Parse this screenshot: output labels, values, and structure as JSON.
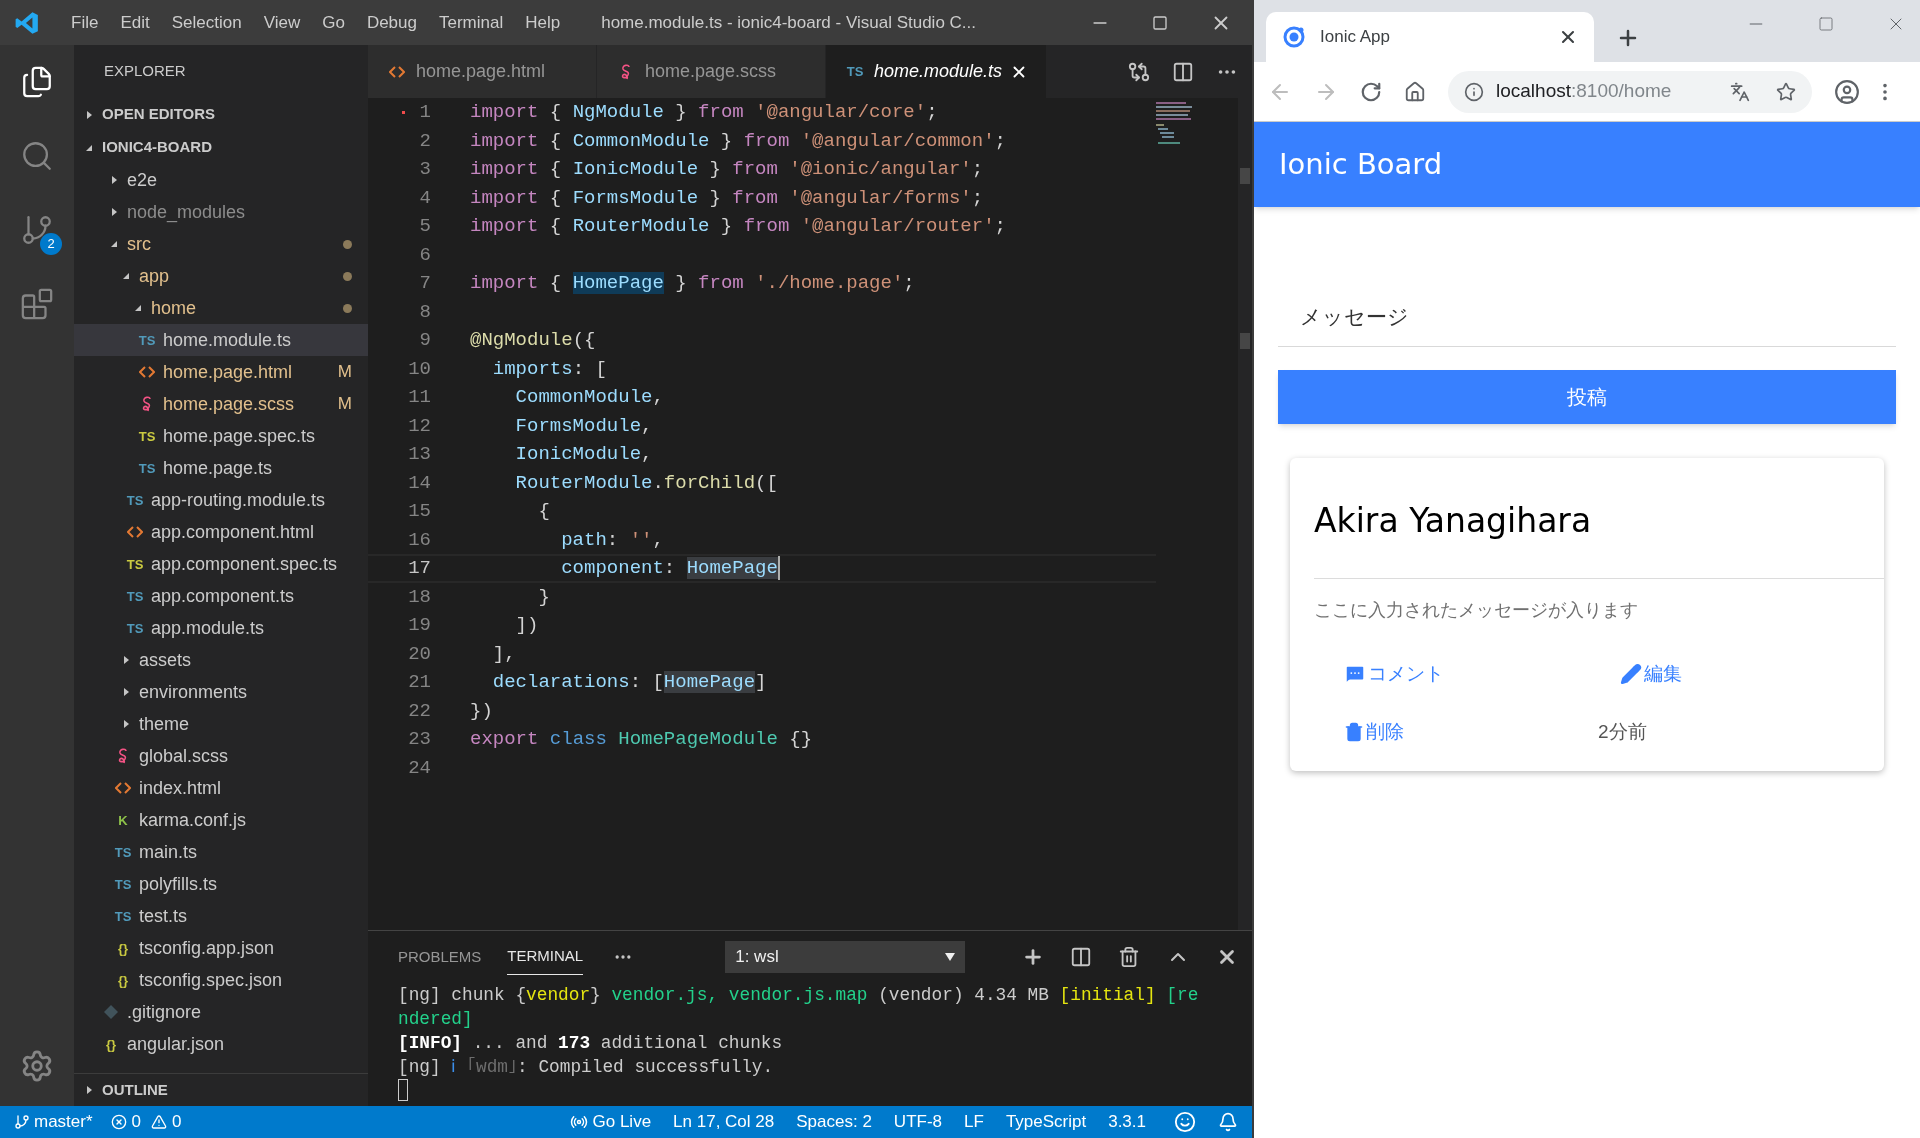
{
  "window": {
    "title": "home.module.ts - ionic4-board - Visual Studio C..."
  },
  "menu": [
    "File",
    "Edit",
    "Selection",
    "View",
    "Go",
    "Debug",
    "Terminal",
    "Help"
  ],
  "activity_bar": [
    {
      "kind": "files",
      "selected": true
    },
    {
      "kind": "search",
      "selected": false
    },
    {
      "kind": "scm",
      "selected": false,
      "badge": "2"
    },
    {
      "kind": "extensions",
      "selected": false
    }
  ],
  "sidebar": {
    "title": "EXPLORER",
    "sections": [
      {
        "label": "OPEN EDITORS",
        "expanded": false
      },
      {
        "label": "IONIC4-BOARD",
        "expanded": true,
        "children": [
          {
            "name": "e2e",
            "expanded": false,
            "selected": false,
            "modified": false,
            "ignored": false
          },
          {
            "name": "node_modules",
            "expanded": false,
            "selected": false,
            "modified": false,
            "ignored": true
          },
          {
            "name": "src",
            "expanded": true,
            "selected": false,
            "modified": true,
            "ignored": false,
            "children": [
              {
                "name": "app",
                "expanded": true,
                "selected": false,
                "modified": true,
                "ignored": false,
                "children": [
                  {
                    "name": "home",
                    "expanded": true,
                    "selected": false,
                    "modified": true,
                    "ignored": false,
                    "children": [
                      {
                        "name": "home.module.ts",
                        "kind": "ts",
                        "icon_text": "TS",
                        "selected": true,
                        "modified": false,
                        "ignored": false
                      },
                      {
                        "name": "home.page.html",
                        "kind": "html",
                        "selected": false,
                        "modified": true,
                        "ignored": false,
                        "badge": "M"
                      },
                      {
                        "name": "home.page.scss",
                        "kind": "scss",
                        "selected": false,
                        "modified": true,
                        "ignored": false,
                        "badge": "M"
                      },
                      {
                        "name": "home.page.spec.ts",
                        "kind": "ts-test",
                        "icon_text": "TS",
                        "selected": false,
                        "modified": false,
                        "ignored": false
                      },
                      {
                        "name": "home.page.ts",
                        "kind": "ts",
                        "icon_text": "TS",
                        "selected": false,
                        "modified": false,
                        "ignored": false
                      }
                    ]
                  },
                  {
                    "name": "app-routing.module.ts",
                    "kind": "ts",
                    "icon_text": "TS",
                    "selected": false,
                    "modified": false,
                    "ignored": false
                  },
                  {
                    "name": "app.component.html",
                    "kind": "html",
                    "selected": false,
                    "modified": false,
                    "ignored": false
                  },
                  {
                    "name": "app.component.spec.ts",
                    "kind": "ts-test",
                    "icon_text": "TS",
                    "selected": false,
                    "modified": false,
                    "ignored": false
                  },
                  {
                    "name": "app.component.ts",
                    "kind": "ts",
                    "icon_text": "TS",
                    "selected": false,
                    "modified": false,
                    "ignored": false
                  },
                  {
                    "name": "app.module.ts",
                    "kind": "ts",
                    "icon_text": "TS",
                    "selected": false,
                    "modified": false,
                    "ignored": false
                  }
                ]
              },
              {
                "name": "assets",
                "expanded": false,
                "selected": false,
                "modified": false,
                "ignored": false
              },
              {
                "name": "environments",
                "expanded": false,
                "selected": false,
                "modified": false,
                "ignored": false
              },
              {
                "name": "theme",
                "expanded": false,
                "selected": false,
                "modified": false,
                "ignored": false
              },
              {
                "name": "global.scss",
                "kind": "scss",
                "selected": false,
                "modified": false,
                "ignored": false
              },
              {
                "name": "index.html",
                "kind": "html",
                "selected": false,
                "modified": false,
                "ignored": false
              },
              {
                "name": "karma.conf.js",
                "kind": "karma",
                "icon_text": "K",
                "selected": false,
                "modified": false,
                "ignored": false
              },
              {
                "name": "main.ts",
                "kind": "ts",
                "icon_text": "TS",
                "selected": false,
                "modified": false,
                "ignored": false
              },
              {
                "name": "polyfills.ts",
                "kind": "ts",
                "icon_text": "TS",
                "selected": false,
                "modified": false,
                "ignored": false
              },
              {
                "name": "test.ts",
                "kind": "ts",
                "icon_text": "TS",
                "selected": false,
                "modified": false,
                "ignored": false
              },
              {
                "name": "tsconfig.app.json",
                "kind": "json",
                "icon_text": "{}",
                "selected": false,
                "modified": false,
                "ignored": false
              },
              {
                "name": "tsconfig.spec.json",
                "kind": "json",
                "icon_text": "{}",
                "selected": false,
                "modified": false,
                "ignored": false
              }
            ]
          },
          {
            "name": ".gitignore",
            "kind": "git",
            "selected": false,
            "modified": false,
            "ignored": false
          },
          {
            "name": "angular.json",
            "kind": "json",
            "icon_text": "{}",
            "selected": false,
            "modified": false,
            "ignored": false
          }
        ]
      },
      {
        "label": "OUTLINE",
        "expanded": false
      }
    ]
  },
  "editor_tabs": [
    {
      "label": "home.page.html",
      "kind": "html",
      "selected": false,
      "preview": false
    },
    {
      "label": "home.page.scss",
      "kind": "scss",
      "selected": false,
      "preview": false
    },
    {
      "label": "home.module.ts",
      "kind": "ts",
      "icon_text": "TS",
      "selected": true,
      "preview": true
    }
  ],
  "code": [
    {
      "n": "1",
      "marker": true,
      "current": false,
      "tokens": [
        {
          "kind": "kw",
          "text": "import"
        },
        {
          "kind": "p",
          "text": " { "
        },
        {
          "kind": "v",
          "text": "NgModule"
        },
        {
          "kind": "p",
          "text": " } "
        },
        {
          "kind": "kw",
          "text": "from"
        },
        {
          "kind": "s",
          "text": " '@angular/core'"
        },
        {
          "kind": "p",
          "text": ";"
        }
      ]
    },
    {
      "n": "2",
      "marker": false,
      "current": false,
      "tokens": [
        {
          "kind": "kw",
          "text": "import"
        },
        {
          "kind": "p",
          "text": " { "
        },
        {
          "kind": "v",
          "text": "CommonModule"
        },
        {
          "kind": "p",
          "text": " } "
        },
        {
          "kind": "kw",
          "text": "from"
        },
        {
          "kind": "s",
          "text": " '@angular/common'"
        },
        {
          "kind": "p",
          "text": ";"
        }
      ]
    },
    {
      "n": "3",
      "marker": false,
      "current": false,
      "tokens": [
        {
          "kind": "kw",
          "text": "import"
        },
        {
          "kind": "p",
          "text": " { "
        },
        {
          "kind": "v",
          "text": "IonicModule"
        },
        {
          "kind": "p",
          "text": " } "
        },
        {
          "kind": "kw",
          "text": "from"
        },
        {
          "kind": "s",
          "text": " '@ionic/angular'"
        },
        {
          "kind": "p",
          "text": ";"
        }
      ]
    },
    {
      "n": "4",
      "marker": false,
      "current": false,
      "tokens": [
        {
          "kind": "kw",
          "text": "import"
        },
        {
          "kind": "p",
          "text": " { "
        },
        {
          "kind": "v",
          "text": "FormsModule"
        },
        {
          "kind": "p",
          "text": " } "
        },
        {
          "kind": "kw",
          "text": "from"
        },
        {
          "kind": "s",
          "text": " '@angular/forms'"
        },
        {
          "kind": "p",
          "text": ";"
        }
      ]
    },
    {
      "n": "5",
      "marker": false,
      "current": false,
      "tokens": [
        {
          "kind": "kw",
          "text": "import"
        },
        {
          "kind": "p",
          "text": " { "
        },
        {
          "kind": "v",
          "text": "RouterModule"
        },
        {
          "kind": "p",
          "text": " } "
        },
        {
          "kind": "kw",
          "text": "from"
        },
        {
          "kind": "s",
          "text": " '@angular/router'"
        },
        {
          "kind": "p",
          "text": ";"
        }
      ]
    },
    {
      "n": "6",
      "marker": false,
      "current": false
    },
    {
      "n": "7",
      "marker": false,
      "current": false,
      "tokens": [
        {
          "kind": "kw",
          "text": "import"
        },
        {
          "kind": "p",
          "text": " { "
        },
        {
          "kind": "v",
          "text": "HomePage",
          "matched": true
        },
        {
          "kind": "p",
          "text": " } "
        },
        {
          "kind": "kw",
          "text": "from"
        },
        {
          "kind": "s",
          "text": " './home.page'"
        },
        {
          "kind": "p",
          "text": ";"
        }
      ]
    },
    {
      "n": "8",
      "marker": false,
      "current": false
    },
    {
      "n": "9",
      "marker": false,
      "current": false,
      "tokens": [
        {
          "kind": "fn",
          "text": "@NgModule"
        },
        {
          "kind": "p",
          "text": "({"
        }
      ]
    },
    {
      "n": "10",
      "marker": false,
      "current": false,
      "tokens": [
        {
          "kind": "pr",
          "text": "  imports"
        },
        {
          "kind": "p",
          "text": ": ["
        }
      ]
    },
    {
      "n": "11",
      "marker": false,
      "current": false,
      "tokens": [
        {
          "kind": "v",
          "text": "    CommonModule"
        },
        {
          "kind": "p",
          "text": ","
        }
      ]
    },
    {
      "n": "12",
      "marker": false,
      "current": false,
      "tokens": [
        {
          "kind": "v",
          "text": "    FormsModule"
        },
        {
          "kind": "p",
          "text": ","
        }
      ]
    },
    {
      "n": "13",
      "marker": false,
      "current": false,
      "tokens": [
        {
          "kind": "v",
          "text": "    IonicModule"
        },
        {
          "kind": "p",
          "text": ","
        }
      ]
    },
    {
      "n": "14",
      "marker": false,
      "current": false,
      "tokens": [
        {
          "kind": "v",
          "text": "    RouterModule"
        },
        {
          "kind": "p",
          "text": "."
        },
        {
          "kind": "fn",
          "text": "forChild"
        },
        {
          "kind": "p",
          "text": "(["
        }
      ]
    },
    {
      "n": "15",
      "marker": false,
      "current": false,
      "tokens": [
        {
          "kind": "p",
          "text": "      {"
        }
      ]
    },
    {
      "n": "16",
      "marker": false,
      "current": false,
      "tokens": [
        {
          "kind": "pr",
          "text": "        path"
        },
        {
          "kind": "p",
          "text": ": "
        },
        {
          "kind": "s",
          "text": "''"
        },
        {
          "kind": "p",
          "text": ","
        }
      ]
    },
    {
      "n": "17",
      "marker": false,
      "current": true,
      "tokens": [
        {
          "kind": "pr",
          "text": "        component"
        },
        {
          "kind": "p",
          "text": ": "
        },
        {
          "kind": "v",
          "text": "HomePage",
          "selected": true
        }
      ]
    },
    {
      "n": "18",
      "marker": false,
      "current": false,
      "tokens": [
        {
          "kind": "p",
          "text": "      }"
        }
      ]
    },
    {
      "n": "19",
      "marker": false,
      "current": false,
      "tokens": [
        {
          "kind": "p",
          "text": "    ])"
        }
      ]
    },
    {
      "n": "20",
      "marker": false,
      "current": false,
      "tokens": [
        {
          "kind": "p",
          "text": "  ],"
        }
      ]
    },
    {
      "n": "21",
      "marker": false,
      "current": false,
      "tokens": [
        {
          "kind": "pr",
          "text": "  declarations"
        },
        {
          "kind": "p",
          "text": ": ["
        },
        {
          "kind": "v",
          "text": "HomePage",
          "selected": true
        },
        {
          "kind": "p",
          "text": "]"
        }
      ]
    },
    {
      "n": "22",
      "marker": false,
      "current": false,
      "tokens": [
        {
          "kind": "p",
          "text": "})"
        }
      ]
    },
    {
      "n": "23",
      "marker": false,
      "current": false,
      "tokens": [
        {
          "kind": "kw",
          "text": "export"
        },
        {
          "kind": "st",
          "text": " class"
        },
        {
          "kind": "ty",
          "text": " HomePageModule"
        },
        {
          "kind": "p",
          "text": " {}"
        }
      ]
    },
    {
      "n": "24",
      "marker": false,
      "current": false
    }
  ],
  "panel": {
    "tabs": [
      {
        "label": "PROBLEMS",
        "selected": false
      },
      {
        "label": "TERMINAL",
        "selected": true
      }
    ],
    "terminal_select": "1: wsl",
    "lines": [
      [
        {
          "kind": "p",
          "text": "[ng] chunk {"
        },
        {
          "kind": "y",
          "text": "vendor"
        },
        {
          "kind": "p",
          "text": "} "
        },
        {
          "kind": "g",
          "text": "vendor.js, vendor.js.map"
        },
        {
          "kind": "p",
          "text": " (vendor) 4.34 MB "
        },
        {
          "kind": "y",
          "text": "[initial]"
        },
        {
          "kind": "g",
          "text": " [rendered]"
        }
      ],
      [
        {
          "kind": "b",
          "text": "[INFO]"
        },
        {
          "kind": "p",
          "text": " ... and "
        },
        {
          "kind": "b",
          "text": "173"
        },
        {
          "kind": "p",
          "text": " additional chunks"
        }
      ],
      [
        {
          "kind": "p",
          "text": "[ng] "
        },
        {
          "kind": "i",
          "text": "ℹ"
        },
        {
          "kind": "d",
          "text": " ｢wdm｣"
        },
        {
          "kind": "p",
          "text": ": Compiled successfully."
        }
      ]
    ]
  },
  "status_bar": {
    "branch": "master*",
    "errors": "0",
    "warnings": "0",
    "go_live": "Go Live",
    "items": [
      "Ln 17, Col 28",
      "Spaces: 2",
      "UTF-8",
      "LF",
      "TypeScript",
      "3.3.1"
    ]
  },
  "browser": {
    "tab": {
      "title": "Ionic App"
    },
    "back": {
      "disabled": true
    },
    "forward": {
      "disabled": true
    },
    "address": {
      "host": "localhost",
      "path": ":8100/home"
    },
    "app": {
      "title": "Ionic Board",
      "input": {
        "placeholder": "メッセージ"
      },
      "submit": "投稿",
      "posts": [
        {
          "author": "Akira Yanagihara",
          "message": "ここに入力されたメッセージが入ります",
          "comment": "コメント",
          "edit": "編集",
          "delete": "削除",
          "time": "2分前"
        }
      ]
    }
  }
}
